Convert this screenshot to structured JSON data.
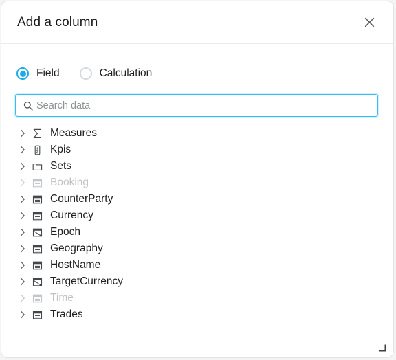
{
  "dialog": {
    "title": "Add a column",
    "close_label": "Close",
    "close_icon": "close-icon",
    "resize_icon": "resize-grip-icon"
  },
  "mode": {
    "selected": "Field",
    "options": [
      {
        "label": "Field",
        "selected": true
      },
      {
        "label": "Calculation",
        "selected": false
      }
    ]
  },
  "search": {
    "placeholder": "Search data",
    "value": "",
    "icon": "search-icon",
    "focused": true
  },
  "tree": {
    "items": [
      {
        "label": "Measures",
        "icon": "sigma-icon",
        "expanded": false,
        "disabled": false
      },
      {
        "label": "Kpis",
        "icon": "kpi-icon",
        "expanded": false,
        "disabled": false
      },
      {
        "label": "Sets",
        "icon": "folder-icon",
        "expanded": false,
        "disabled": false
      },
      {
        "label": "Booking",
        "icon": "table-icon",
        "expanded": false,
        "disabled": true
      },
      {
        "label": "CounterParty",
        "icon": "table-icon",
        "expanded": false,
        "disabled": false
      },
      {
        "label": "Currency",
        "icon": "table-icon",
        "expanded": false,
        "disabled": false
      },
      {
        "label": "Epoch",
        "icon": "view-icon",
        "expanded": false,
        "disabled": false
      },
      {
        "label": "Geography",
        "icon": "table-icon",
        "expanded": false,
        "disabled": false
      },
      {
        "label": "HostName",
        "icon": "table-icon",
        "expanded": false,
        "disabled": false
      },
      {
        "label": "TargetCurrency",
        "icon": "view-icon",
        "expanded": false,
        "disabled": false
      },
      {
        "label": "Time",
        "icon": "table-icon",
        "expanded": false,
        "disabled": true
      },
      {
        "label": "Trades",
        "icon": "table-icon",
        "expanded": false,
        "disabled": false
      }
    ]
  },
  "colors": {
    "accent": "#1cabe9",
    "focus_border": "#38bdf0",
    "text": "#1f1f1f",
    "text_disabled": "#c0c3c6",
    "border": "#e3e3e3"
  }
}
